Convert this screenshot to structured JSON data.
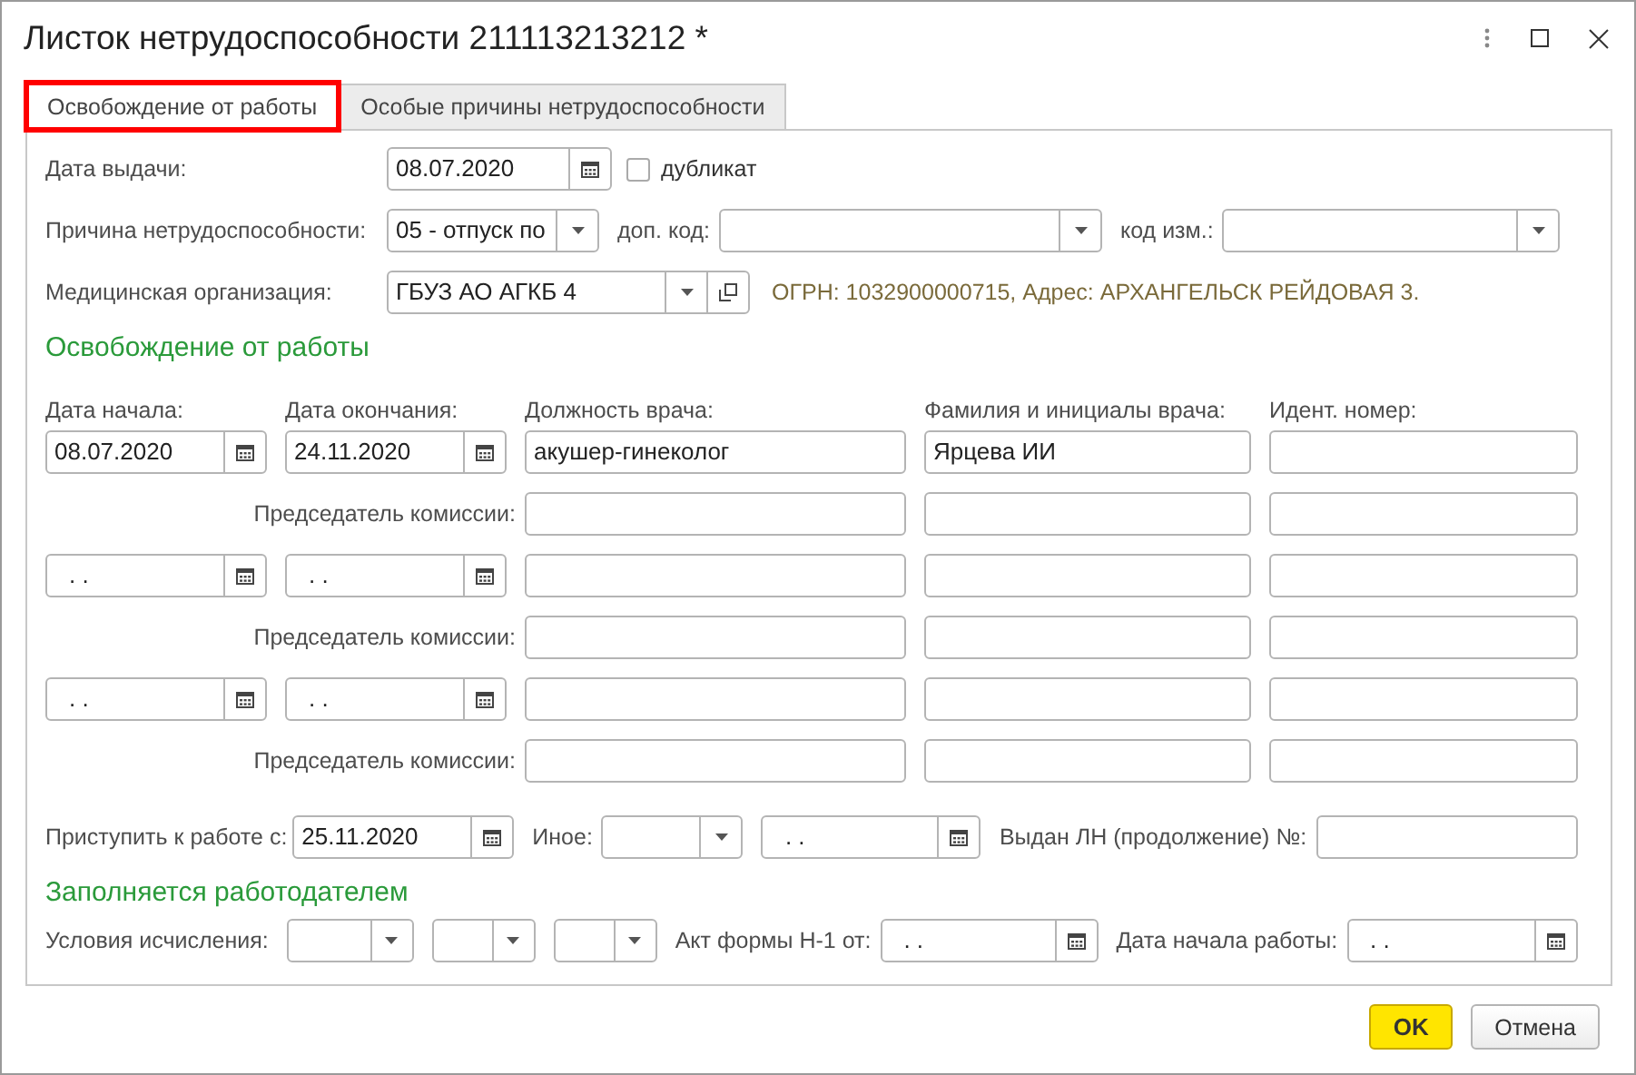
{
  "window": {
    "title": "Листок нетрудоспособности 211113213212 *"
  },
  "tabs": [
    {
      "label": "Освобождение от работы",
      "selected": true,
      "outlined": true
    },
    {
      "label": "Особые причины нетрудоспособности",
      "selected": false,
      "outlined": false
    }
  ],
  "issue_date": {
    "label": "Дата выдачи:",
    "value": "08.07.2020"
  },
  "duplicate": {
    "label": "дубликат",
    "checked": false
  },
  "reason": {
    "label": "Причина нетрудоспособности:",
    "value": "05 - отпуск по"
  },
  "extra_code": {
    "label": "доп. код:"
  },
  "change_code": {
    "label": "код изм.:"
  },
  "medical_org": {
    "label": "Медицинская организация:",
    "value": "ГБУЗ АО АГКБ 4",
    "info": "ОГРН: 1032900000715, Адрес: АРХАНГЕЛЬСК РЕЙДОВАЯ 3."
  },
  "release": {
    "title": "Освобождение от работы",
    "columns": [
      "Дата начала:",
      "Дата окончания:",
      "Должность врача:",
      "Фамилия и инициалы врача:",
      "Идент.  номер:"
    ],
    "periods": [
      {
        "start": "08.07.2020",
        "end": "24.11.2020",
        "position": "акушер-гинеколог",
        "doctor": "Ярцева ИИ",
        "chairman_label": "Председатель комиссии:"
      },
      {
        "start": ". .",
        "end": ". .",
        "chairman_label": "Председатель комиссии:"
      },
      {
        "start": ". .",
        "end": ". .",
        "chairman_label": "Председатель комиссии:"
      }
    ]
  },
  "return_to_work": {
    "label": "Приступить к работе с:",
    "value": "25.11.2020"
  },
  "other": {
    "label": "Иное:",
    "date": ". ."
  },
  "continued": {
    "label": "Выдан ЛН (продолжение) №:"
  },
  "employer": {
    "title": "Заполняется работодателем",
    "conditions_label": "Условия исчисления:",
    "act_label": "Акт формы Н-1 от:",
    "act_date": ". .",
    "start_label": "Дата начала работы:",
    "start_date": ". ."
  },
  "buttons": [
    {
      "label": "OK",
      "default": true
    },
    {
      "label": "Отмена",
      "default": false
    }
  ]
}
